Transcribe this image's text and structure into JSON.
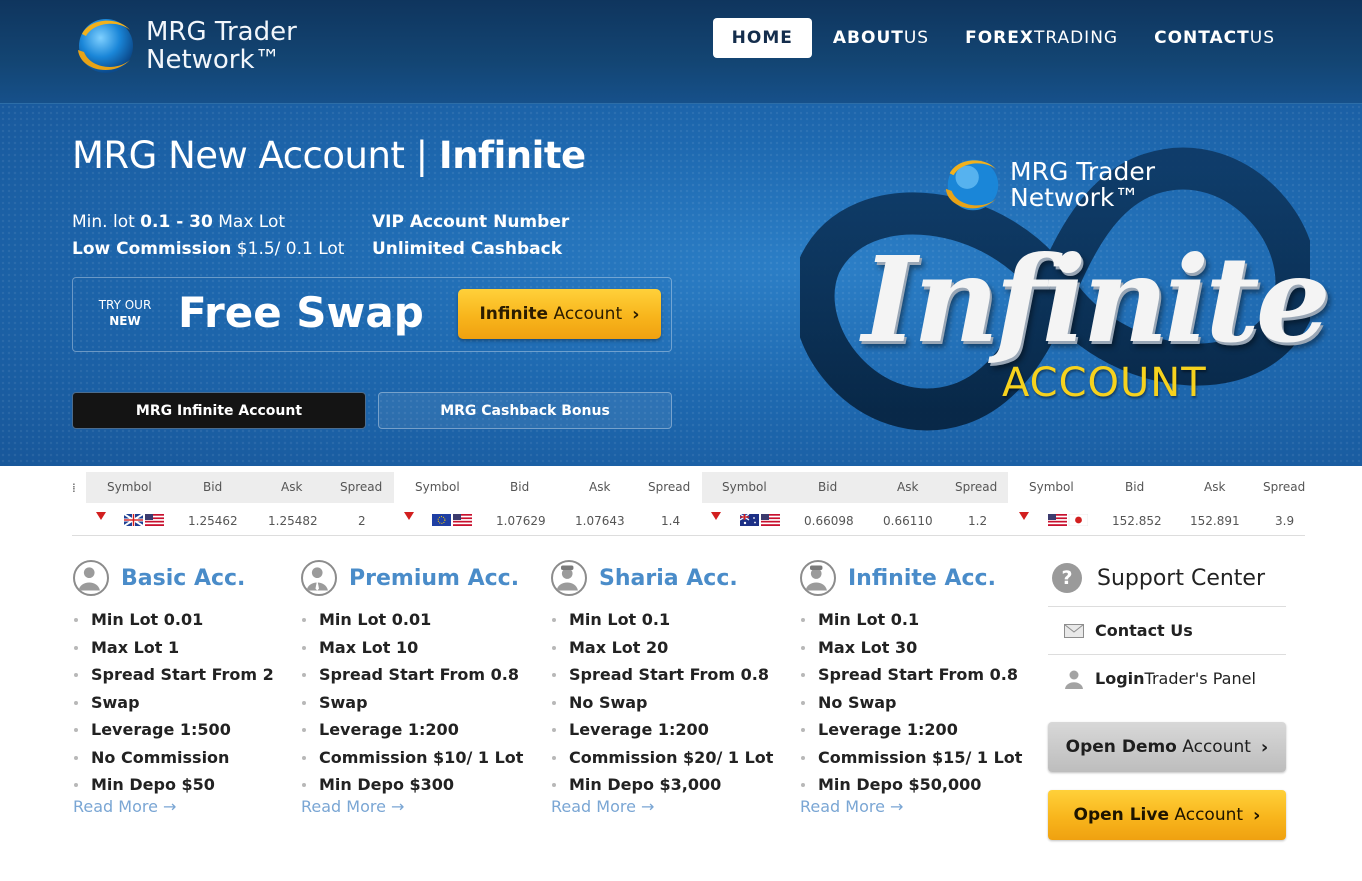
{
  "brand": {
    "line1": "MRG Trader",
    "line2": "Network™"
  },
  "nav": [
    {
      "label": "HOME"
    },
    {
      "bold": "ABOUT",
      "rest": " US"
    },
    {
      "bold": "FOREX",
      "rest": " TRADING"
    },
    {
      "bold": "CONTACT",
      "rest": " US"
    }
  ],
  "hero": {
    "title_prefix": "MRG New Account | ",
    "title_bold": "Infinite",
    "features": {
      "a_pre": "Min. lot ",
      "a_bold": "0.1 - 30",
      "a_post": " Max Lot",
      "b_bold": "Low Commission",
      "b_post": " $1.5/ 0.1 Lot",
      "c": "VIP Account Number",
      "d": "Unlimited Cashback"
    },
    "promo_try": "TRY OUR",
    "promo_new": "NEW",
    "promo_headline": "Free Swap",
    "promo_button_bold": "Infinite",
    "promo_button_rest": " Account",
    "tab_active": "MRG Infinite Account",
    "tab_inactive": "MRG Cashback Bonus",
    "art_logo_line1": "MRG Trader",
    "art_logo_line2": "Network™",
    "art_word": "Infinite",
    "art_sub": "ACCOUNT"
  },
  "ticker": {
    "headers": [
      "Symbol",
      "Bid",
      "Ask",
      "Spread"
    ],
    "quotes": [
      {
        "flag": "gb-us",
        "bid": "1.25462",
        "ask": "1.25482",
        "spread": "2"
      },
      {
        "flag": "eu-us",
        "bid": "1.07629",
        "ask": "1.07643",
        "spread": "1.4"
      },
      {
        "flag": "au-us",
        "bid": "0.66098",
        "ask": "0.66110",
        "spread": "1.2"
      },
      {
        "flag": "us-jp",
        "bid": "152.852",
        "ask": "152.891",
        "spread": "3.9"
      }
    ]
  },
  "accounts": [
    {
      "title": "Basic Acc.",
      "avatar": "user-icon",
      "items": [
        "Min Lot 0.01",
        "Max Lot 1",
        "Spread Start From 2",
        "Swap",
        "Leverage 1:500",
        "No Commission",
        "Min Depo $50"
      ],
      "read_more": "Read More →"
    },
    {
      "title": "Premium Acc.",
      "avatar": "user-icon",
      "items": [
        "Min Lot 0.01",
        "Max Lot 10",
        "Spread Start From 0.8",
        "Swap",
        "Leverage 1:200",
        "Commission $10/ 1 Lot",
        "Min Depo $300"
      ],
      "read_more": "Read More →"
    },
    {
      "title": "Sharia Acc.",
      "avatar": "user-icon",
      "items": [
        "Min Lot 0.1",
        "Max Lot 20",
        "Spread Start From 0.8",
        "No Swap",
        "Leverage 1:200",
        "Commission $20/ 1 Lot",
        "Min Depo $3,000"
      ],
      "read_more": "Read More →"
    },
    {
      "title": "Infinite Acc.",
      "avatar": "user-icon",
      "items": [
        "Min Lot 0.1",
        "Max Lot 30",
        "Spread Start From 0.8",
        "No Swap",
        "Leverage 1:200",
        "Commission $15/ 1 Lot",
        "Min Depo $50,000"
      ],
      "read_more": "Read More →"
    }
  ],
  "support": {
    "title": "Support Center",
    "contact": "Contact Us",
    "login_bold": "Login",
    "login_rest": "Trader's Panel",
    "demo_bold": "Open Demo",
    "demo_rest": " Account",
    "live_bold": "Open Live",
    "live_rest": " Account"
  },
  "colors": {
    "accent": "#4a8cc9",
    "button_yellow": "#f8b51c",
    "header": "#134573",
    "hero": "#1e69b0"
  }
}
